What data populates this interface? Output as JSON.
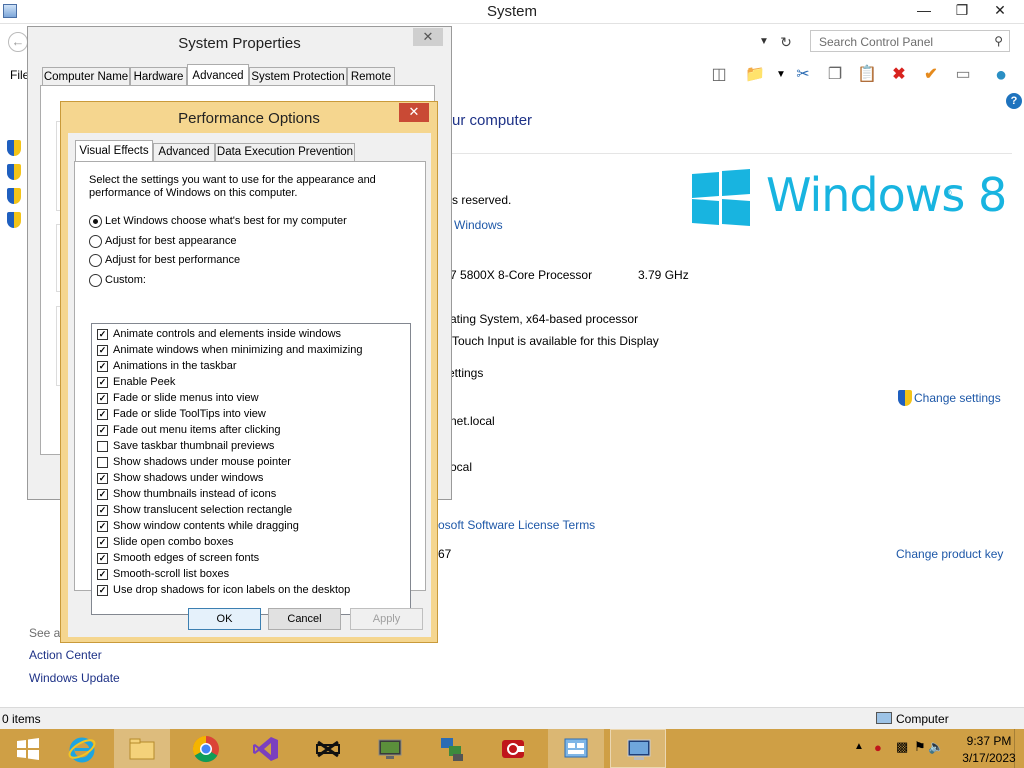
{
  "system_window": {
    "title": "System",
    "search_placeholder": "Search Control Panel",
    "menu_file": "File",
    "heading_partial": "ur computer",
    "fragments": {
      "rights": "s reserved.",
      "windows_link": "Windows",
      "processor": "n 7 5800X 8-Core Processor",
      "speed": "3.79 GHz",
      "system_type": "rating System, x64-based processor",
      "touch": "Touch Input is available for this Display",
      "settings": "ettings",
      "domain": "net.local",
      "local": "ocal",
      "license": "osoft Software License Terms",
      "product_id": "67"
    },
    "change_settings": "Change settings",
    "change_product_key": "Change product key",
    "see_also": "See al",
    "see_also_links": [
      "Action Center",
      "Windows Update"
    ],
    "logo_text": "Windows",
    "logo_version": "8",
    "status_items": "0 items",
    "status_location": "Computer"
  },
  "system_properties": {
    "title": "System Properties",
    "tabs": [
      "Computer Name",
      "Hardware",
      "Advanced",
      "System Protection",
      "Remote"
    ],
    "selected_tab": "Advanced"
  },
  "performance_options": {
    "title": "Performance Options",
    "tabs": [
      "Visual Effects",
      "Advanced",
      "Data Execution Prevention"
    ],
    "selected_tab": "Visual Effects",
    "description": "Select the settings you want to use for the appearance and performance of Windows on this computer.",
    "radios": [
      {
        "label": "Let Windows choose what's best for my computer",
        "selected": true
      },
      {
        "label": "Adjust for best appearance",
        "selected": false
      },
      {
        "label": "Adjust for best performance",
        "selected": false
      },
      {
        "label": "Custom:",
        "selected": false
      }
    ],
    "effects": [
      {
        "label": "Animate controls and elements inside windows",
        "checked": true
      },
      {
        "label": "Animate windows when minimizing and maximizing",
        "checked": true
      },
      {
        "label": "Animations in the taskbar",
        "checked": true
      },
      {
        "label": "Enable Peek",
        "checked": true
      },
      {
        "label": "Fade or slide menus into view",
        "checked": true
      },
      {
        "label": "Fade or slide ToolTips into view",
        "checked": true
      },
      {
        "label": "Fade out menu items after clicking",
        "checked": true
      },
      {
        "label": "Save taskbar thumbnail previews",
        "checked": false
      },
      {
        "label": "Show shadows under mouse pointer",
        "checked": false
      },
      {
        "label": "Show shadows under windows",
        "checked": true
      },
      {
        "label": "Show thumbnails instead of icons",
        "checked": true
      },
      {
        "label": "Show translucent selection rectangle",
        "checked": true
      },
      {
        "label": "Show window contents while dragging",
        "checked": true
      },
      {
        "label": "Slide open combo boxes",
        "checked": true
      },
      {
        "label": "Smooth edges of screen fonts",
        "checked": true
      },
      {
        "label": "Smooth-scroll list boxes",
        "checked": true
      },
      {
        "label": "Use drop shadows for icon labels on the desktop",
        "checked": true
      }
    ],
    "buttons": {
      "ok": "OK",
      "cancel": "Cancel",
      "apply": "Apply"
    }
  },
  "taskbar": {
    "apps": [
      "start",
      "internet-explorer",
      "file-explorer",
      "chrome",
      "visual-studio",
      "capcut",
      "remote-desktop",
      "network-tool",
      "screen-recorder",
      "control-panel",
      "system"
    ],
    "active_app": "system",
    "time": "9:37 PM",
    "date": "3/17/2023"
  },
  "colors": {
    "taskbar": "#cf9f45",
    "dialog_frame": "#f5d68f",
    "close_red": "#c94a35",
    "link": "#1e3287",
    "windows_logo": "#18b4e0"
  }
}
